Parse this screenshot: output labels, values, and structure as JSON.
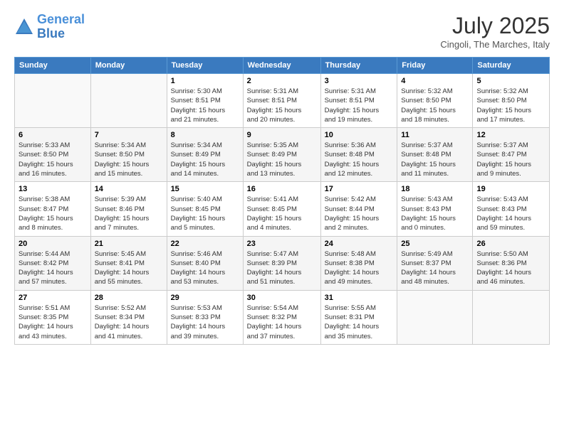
{
  "logo": {
    "line1": "General",
    "line2": "Blue"
  },
  "title": "July 2025",
  "subtitle": "Cingoli, The Marches, Italy",
  "days_header": [
    "Sunday",
    "Monday",
    "Tuesday",
    "Wednesday",
    "Thursday",
    "Friday",
    "Saturday"
  ],
  "weeks": [
    [
      {
        "day": "",
        "info": ""
      },
      {
        "day": "",
        "info": ""
      },
      {
        "day": "1",
        "info": "Sunrise: 5:30 AM\nSunset: 8:51 PM\nDaylight: 15 hours\nand 21 minutes."
      },
      {
        "day": "2",
        "info": "Sunrise: 5:31 AM\nSunset: 8:51 PM\nDaylight: 15 hours\nand 20 minutes."
      },
      {
        "day": "3",
        "info": "Sunrise: 5:31 AM\nSunset: 8:51 PM\nDaylight: 15 hours\nand 19 minutes."
      },
      {
        "day": "4",
        "info": "Sunrise: 5:32 AM\nSunset: 8:50 PM\nDaylight: 15 hours\nand 18 minutes."
      },
      {
        "day": "5",
        "info": "Sunrise: 5:32 AM\nSunset: 8:50 PM\nDaylight: 15 hours\nand 17 minutes."
      }
    ],
    [
      {
        "day": "6",
        "info": "Sunrise: 5:33 AM\nSunset: 8:50 PM\nDaylight: 15 hours\nand 16 minutes."
      },
      {
        "day": "7",
        "info": "Sunrise: 5:34 AM\nSunset: 8:50 PM\nDaylight: 15 hours\nand 15 minutes."
      },
      {
        "day": "8",
        "info": "Sunrise: 5:34 AM\nSunset: 8:49 PM\nDaylight: 15 hours\nand 14 minutes."
      },
      {
        "day": "9",
        "info": "Sunrise: 5:35 AM\nSunset: 8:49 PM\nDaylight: 15 hours\nand 13 minutes."
      },
      {
        "day": "10",
        "info": "Sunrise: 5:36 AM\nSunset: 8:48 PM\nDaylight: 15 hours\nand 12 minutes."
      },
      {
        "day": "11",
        "info": "Sunrise: 5:37 AM\nSunset: 8:48 PM\nDaylight: 15 hours\nand 11 minutes."
      },
      {
        "day": "12",
        "info": "Sunrise: 5:37 AM\nSunset: 8:47 PM\nDaylight: 15 hours\nand 9 minutes."
      }
    ],
    [
      {
        "day": "13",
        "info": "Sunrise: 5:38 AM\nSunset: 8:47 PM\nDaylight: 15 hours\nand 8 minutes."
      },
      {
        "day": "14",
        "info": "Sunrise: 5:39 AM\nSunset: 8:46 PM\nDaylight: 15 hours\nand 7 minutes."
      },
      {
        "day": "15",
        "info": "Sunrise: 5:40 AM\nSunset: 8:45 PM\nDaylight: 15 hours\nand 5 minutes."
      },
      {
        "day": "16",
        "info": "Sunrise: 5:41 AM\nSunset: 8:45 PM\nDaylight: 15 hours\nand 4 minutes."
      },
      {
        "day": "17",
        "info": "Sunrise: 5:42 AM\nSunset: 8:44 PM\nDaylight: 15 hours\nand 2 minutes."
      },
      {
        "day": "18",
        "info": "Sunrise: 5:43 AM\nSunset: 8:43 PM\nDaylight: 15 hours\nand 0 minutes."
      },
      {
        "day": "19",
        "info": "Sunrise: 5:43 AM\nSunset: 8:43 PM\nDaylight: 14 hours\nand 59 minutes."
      }
    ],
    [
      {
        "day": "20",
        "info": "Sunrise: 5:44 AM\nSunset: 8:42 PM\nDaylight: 14 hours\nand 57 minutes."
      },
      {
        "day": "21",
        "info": "Sunrise: 5:45 AM\nSunset: 8:41 PM\nDaylight: 14 hours\nand 55 minutes."
      },
      {
        "day": "22",
        "info": "Sunrise: 5:46 AM\nSunset: 8:40 PM\nDaylight: 14 hours\nand 53 minutes."
      },
      {
        "day": "23",
        "info": "Sunrise: 5:47 AM\nSunset: 8:39 PM\nDaylight: 14 hours\nand 51 minutes."
      },
      {
        "day": "24",
        "info": "Sunrise: 5:48 AM\nSunset: 8:38 PM\nDaylight: 14 hours\nand 49 minutes."
      },
      {
        "day": "25",
        "info": "Sunrise: 5:49 AM\nSunset: 8:37 PM\nDaylight: 14 hours\nand 48 minutes."
      },
      {
        "day": "26",
        "info": "Sunrise: 5:50 AM\nSunset: 8:36 PM\nDaylight: 14 hours\nand 46 minutes."
      }
    ],
    [
      {
        "day": "27",
        "info": "Sunrise: 5:51 AM\nSunset: 8:35 PM\nDaylight: 14 hours\nand 43 minutes."
      },
      {
        "day": "28",
        "info": "Sunrise: 5:52 AM\nSunset: 8:34 PM\nDaylight: 14 hours\nand 41 minutes."
      },
      {
        "day": "29",
        "info": "Sunrise: 5:53 AM\nSunset: 8:33 PM\nDaylight: 14 hours\nand 39 minutes."
      },
      {
        "day": "30",
        "info": "Sunrise: 5:54 AM\nSunset: 8:32 PM\nDaylight: 14 hours\nand 37 minutes."
      },
      {
        "day": "31",
        "info": "Sunrise: 5:55 AM\nSunset: 8:31 PM\nDaylight: 14 hours\nand 35 minutes."
      },
      {
        "day": "",
        "info": ""
      },
      {
        "day": "",
        "info": ""
      }
    ]
  ]
}
